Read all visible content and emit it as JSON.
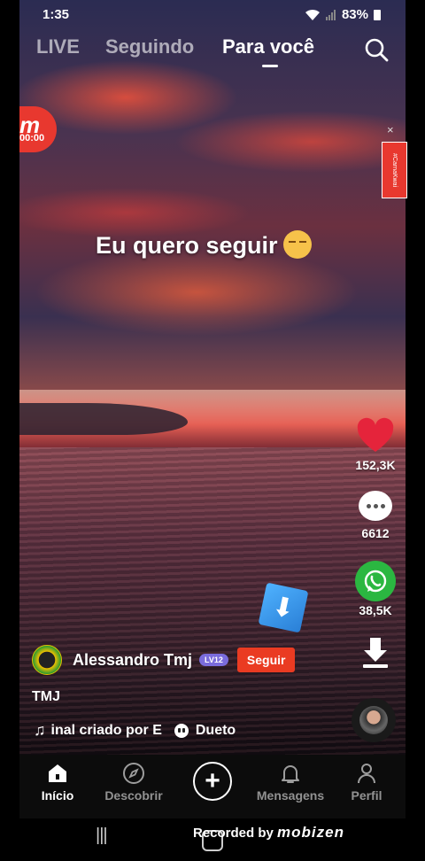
{
  "status": {
    "time": "1:35",
    "battery": "83%"
  },
  "top_tabs": [
    {
      "label": "LIVE",
      "active": false
    },
    {
      "label": "Seguindo",
      "active": false
    },
    {
      "label": "Para você",
      "active": true
    }
  ],
  "floaty": {
    "brand": "m",
    "timer": "00:00"
  },
  "side_banner": {
    "text": "#CarnaKwai"
  },
  "caption": "Eu quero seguir",
  "rail": {
    "likes": "152,3K",
    "comments": "6612",
    "shares": "38,5K",
    "like_color": "#e5243b",
    "whatsapp_color": "#2bb741"
  },
  "author": {
    "name": "Alessandro Tmj",
    "level": "LV12",
    "follow_label": "Seguir"
  },
  "description": "TMJ",
  "music": {
    "label": "inal criado por E",
    "duet_label": "Dueto"
  },
  "bottom_nav": [
    {
      "label": "Início",
      "icon": "home-icon",
      "active": true
    },
    {
      "label": "Descobrir",
      "icon": "compass-icon",
      "active": false
    },
    {
      "label": "Mensagens",
      "icon": "bell-icon",
      "active": false
    },
    {
      "label": "Perfil",
      "icon": "person-icon",
      "active": false
    }
  ],
  "watermark": {
    "prefix": "Recorded by",
    "brand": "mobizen"
  }
}
